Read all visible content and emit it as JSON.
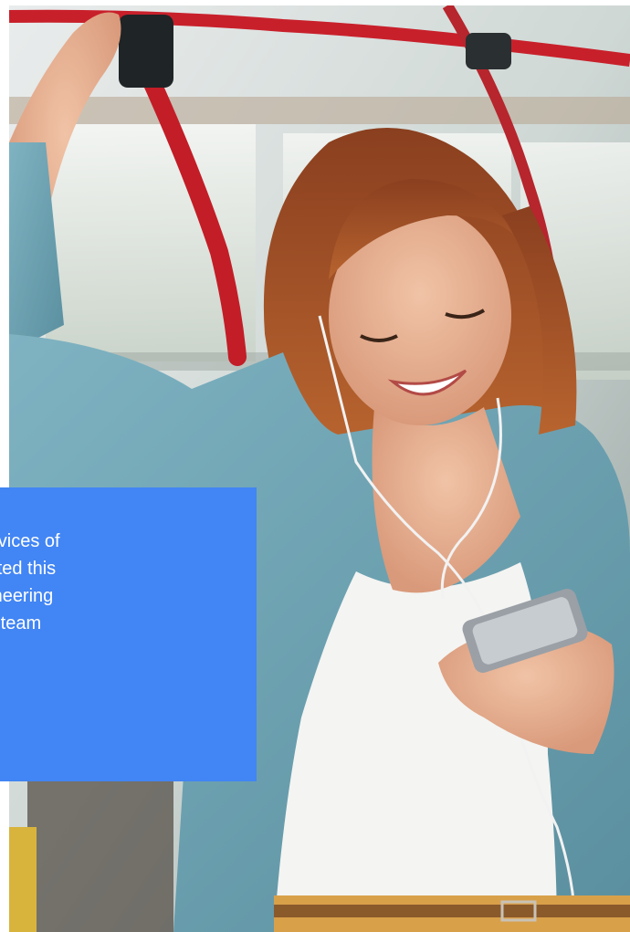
{
  "caption": {
    "lines": [
      "ervices of",
      "pleted this",
      "gineering",
      "es team"
    ]
  },
  "colors": {
    "card": "#4285f4",
    "caption_text": "#ffffff"
  },
  "photo": {
    "icon": "photo-woman-on-bus-icon"
  }
}
